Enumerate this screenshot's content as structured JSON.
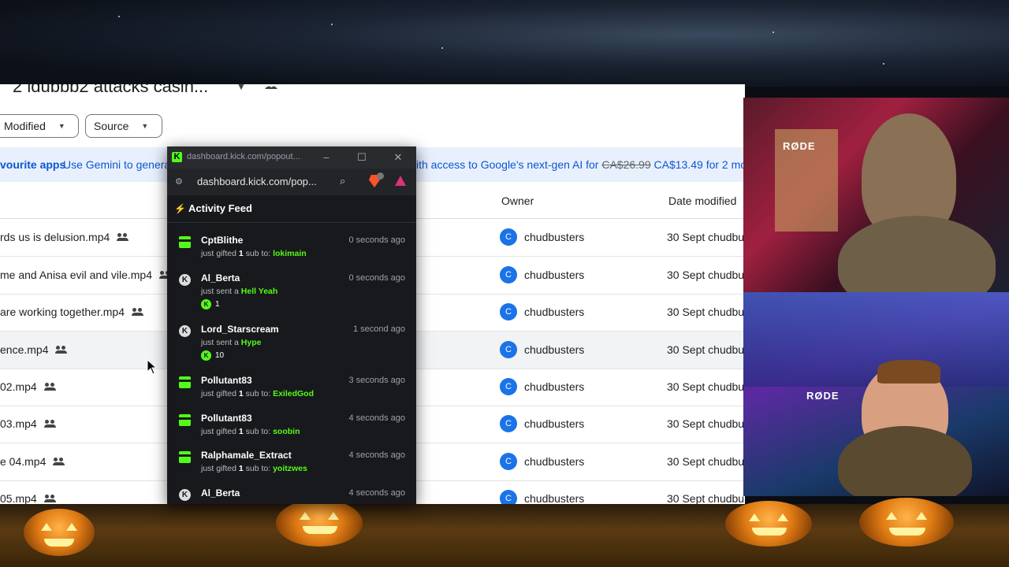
{
  "drive": {
    "folder_title": "2 ldubbb2 attacks casin...",
    "filters": {
      "modified": "Modified",
      "source": "Source"
    },
    "banner": {
      "lead": "vourite apps",
      "text_left": "Use Gemini to genera",
      "text_right": "ith access to Google's next-gen AI for",
      "old_price": "CA$26.99",
      "new_price": "CA$13.49 for 2 mo"
    },
    "columns": {
      "owner": "Owner",
      "date_modified": "Date modified"
    },
    "files": [
      {
        "name": "rds us is delusion.mp4",
        "owner_initial": "C",
        "owner": "chudbusters",
        "date": "30 Sept chudbu"
      },
      {
        "name": "me and Anisa evil and vile.mp4",
        "owner_initial": "C",
        "owner": "chudbusters",
        "date": "30 Sept chudbu"
      },
      {
        "name": " are working together.mp4",
        "owner_initial": "C",
        "owner": "chudbusters",
        "date": "30 Sept chudbu"
      },
      {
        "name": "ence.mp4",
        "owner_initial": "C",
        "owner": "chudbusters",
        "date": "30 Sept chudbu"
      },
      {
        "name": " 02.mp4",
        "owner_initial": "C",
        "owner": "chudbusters",
        "date": "30 Sept chudbu"
      },
      {
        "name": " 03.mp4",
        "owner_initial": "C",
        "owner": "chudbusters",
        "date": "30 Sept chudbu"
      },
      {
        "name": "e 04.mp4",
        "owner_initial": "C",
        "owner": "chudbusters",
        "date": "30 Sept chudbu"
      },
      {
        "name": " 05.mp4",
        "owner_initial": "C",
        "owner": "chudbusters",
        "date": "30 Sept chudbu"
      }
    ]
  },
  "popout": {
    "window_url": "dashboard.kick.com/popout...",
    "address_url": "dashboard.kick.com/pop...",
    "feed_title": "Activity Feed",
    "events": [
      {
        "type": "gift",
        "icon": "gift-icon",
        "user": "CptBlithe",
        "time": "0 seconds ago",
        "prefix": "just gifted ",
        "count": "1",
        "mid": " sub to: ",
        "target": "lokimain"
      },
      {
        "type": "kicks",
        "icon": "kick-icon",
        "user": "Al_Berta",
        "time": "0 seconds ago",
        "prefix": "just sent a ",
        "target": "Hell Yeah",
        "amount": "1"
      },
      {
        "type": "kicks",
        "icon": "kick-icon",
        "user": "Lord_Starscream",
        "time": "1 second ago",
        "prefix": "just sent a ",
        "target": "Hype",
        "amount": "10"
      },
      {
        "type": "gift",
        "icon": "gift-icon",
        "user": "Pollutant83",
        "time": "3 seconds ago",
        "prefix": "just gifted ",
        "count": "1",
        "mid": " sub to: ",
        "target": "ExiledGod"
      },
      {
        "type": "gift",
        "icon": "gift-icon",
        "user": "Pollutant83",
        "time": "4 seconds ago",
        "prefix": "just gifted ",
        "count": "1",
        "mid": " sub to: ",
        "target": "soobin"
      },
      {
        "type": "gift",
        "icon": "gift-icon",
        "user": "Ralphamale_Extract",
        "time": "4 seconds ago",
        "prefix": "just gifted ",
        "count": "1",
        "mid": " sub to: ",
        "target": "yoitzwes"
      },
      {
        "type": "kicks",
        "icon": "kick-icon",
        "user": "Al_Berta",
        "time": "4 seconds ago",
        "prefix": "",
        "target": ""
      }
    ]
  },
  "cams": {
    "mic_brand_1": "RØDE",
    "mic_brand_2": "RØDE"
  },
  "colors": {
    "kick_green": "#53fc18",
    "drive_blue": "#0b57d0",
    "banner_bg": "#e8f0fe"
  }
}
